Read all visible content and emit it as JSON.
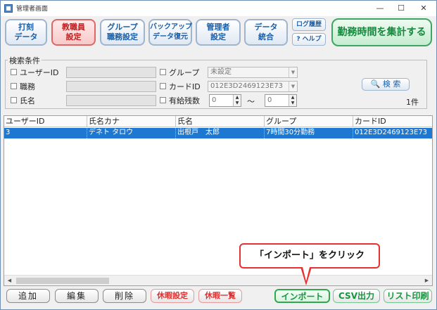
{
  "window": {
    "title": "管理者画面",
    "controls": {
      "minimize": "—",
      "maximize": "☐",
      "close": "✕"
    }
  },
  "toolbar": {
    "buttons": [
      {
        "line1": "打刻",
        "line2": "データ"
      },
      {
        "line1": "教職員",
        "line2": "設定"
      },
      {
        "line1": "グループ",
        "line2": "職務設定"
      },
      {
        "line1": "バックアップ",
        "line2": "データ復元"
      },
      {
        "line1": "管理者",
        "line2": "設定"
      },
      {
        "line1": "データ",
        "line2": "統合"
      }
    ],
    "log_history": "ログ履歴",
    "help": "? ヘルプ",
    "aggregate_button": "勤務時間を集計する"
  },
  "search": {
    "legend": "検索条件",
    "user_id_label": "ユーザーID",
    "job_label": "職務",
    "name_label": "氏名",
    "group_label": "グループ",
    "group_value": "未設定",
    "card_id_label": "カードID",
    "card_id_value": "012E3D2469123E73",
    "paid_leave_label": "有給残数",
    "paid_from": "0",
    "range_sep": "〜",
    "paid_to": "0",
    "search_button": "検 索",
    "result_count": "1件"
  },
  "grid": {
    "headers": [
      "ユーザーID",
      "氏名カナ",
      "氏名",
      "グループ",
      "カードID"
    ],
    "rows": [
      [
        "3",
        "デネト タロウ",
        "出根戸　太郎",
        "7時間30分勤務",
        "012E3D2469123E73"
      ]
    ]
  },
  "footer": {
    "add": "追加",
    "edit": "編集",
    "delete": "削除",
    "leave_setting": "休暇設定",
    "leave_list": "休暇一覧",
    "import": "インポート",
    "csv": "CSV出力",
    "list_print": "リスト印刷"
  },
  "callout": {
    "text": "「インポート」をクリック"
  },
  "colors": {
    "accent_blue": "#1b5ea6",
    "selected_row": "#1e78d2",
    "active_red": "#e06666",
    "green": "#15963f",
    "callout_red": "#e83030"
  }
}
